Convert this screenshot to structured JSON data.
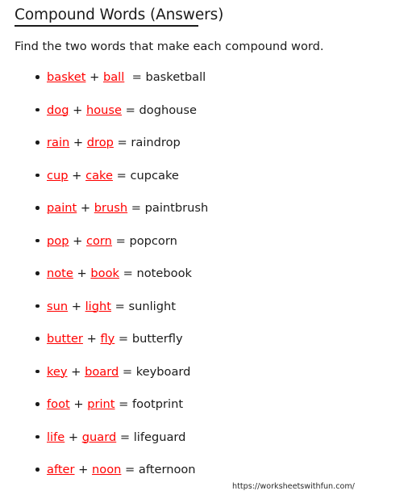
{
  "document": {
    "title": "Compound Words (Answers)",
    "instruction": "Find the two words that make each compound word.",
    "accent_color": "#ff0000",
    "text_color": "#1b1b1b",
    "background_color": "#ffffff"
  },
  "symbols": {
    "plus": "+",
    "equals": "=",
    "bullet": "•"
  },
  "items": [
    {
      "part1": "basket",
      "part2": "ball",
      "compound": "basketball",
      "gap_after_part2": "  "
    },
    {
      "part1": "dog",
      "part2": "house",
      "compound": "doghouse",
      "gap_after_part2": " "
    },
    {
      "part1": "rain",
      "part2": "drop",
      "compound": "raindrop",
      "gap_after_part2": " "
    },
    {
      "part1": "cup",
      "part2": "cake",
      "compound": "cupcake",
      "gap_after_part2": " "
    },
    {
      "part1": "paint",
      "part2": "brush",
      "compound": "paintbrush",
      "gap_after_part2": " "
    },
    {
      "part1": "pop",
      "part2": "corn",
      "compound": "popcorn",
      "gap_after_part2": " "
    },
    {
      "part1": "note",
      "part2": "book",
      "compound": "notebook",
      "gap_after_part2": " "
    },
    {
      "part1": "sun",
      "part2": "light",
      "compound": "sunlight",
      "gap_after_part2": " "
    },
    {
      "part1": "butter",
      "part2": "fly",
      "compound": "butterfly",
      "gap_after_part2": " "
    },
    {
      "part1": "key",
      "part2": "board",
      "compound": "keyboard",
      "gap_after_part2": " "
    },
    {
      "part1": "foot",
      "part2": "print",
      "compound": "footprint",
      "gap_after_part2": " "
    },
    {
      "part1": "life",
      "part2": "guard",
      "compound": "lifeguard",
      "gap_after_part2": " "
    },
    {
      "part1": "after",
      "part2": "noon",
      "compound": "afternoon",
      "gap_after_part2": " "
    }
  ],
  "footer": {
    "url": "https://worksheetswithfun.com/"
  }
}
